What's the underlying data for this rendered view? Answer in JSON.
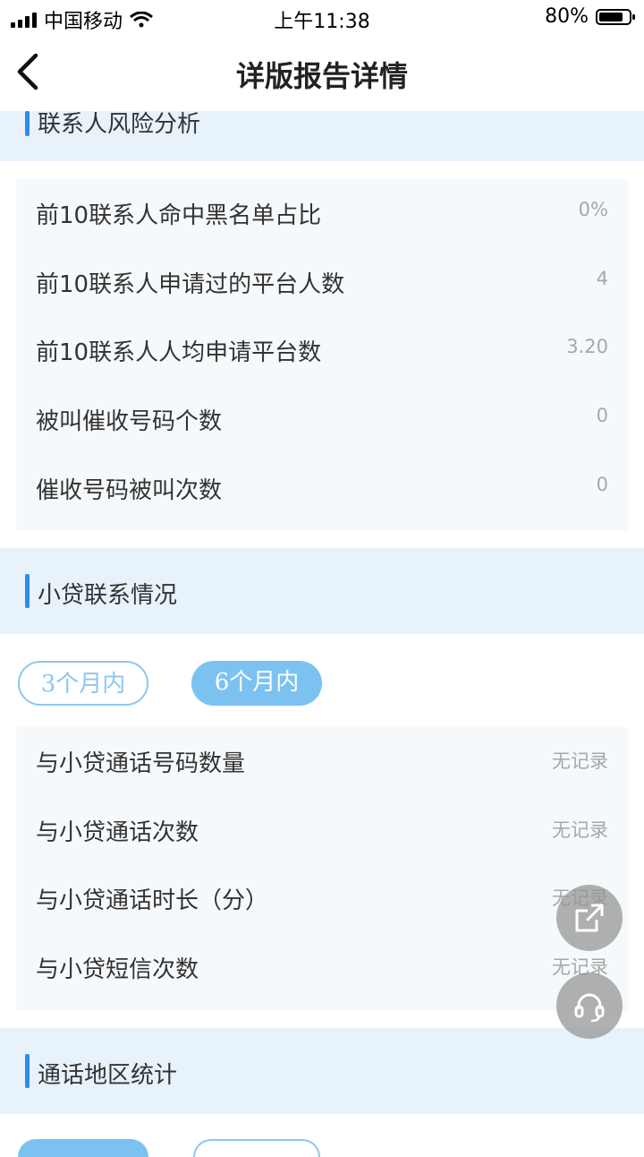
{
  "status_bar": {
    "carrier": "中国移动",
    "time": "上午11:38",
    "battery": "80%"
  },
  "nav": {
    "title": "详版报告详情"
  },
  "contacts_risk": {
    "title": "联系人风险分析",
    "rows": [
      {
        "label": "前10联系人命中黑名单占比",
        "value": "0%"
      },
      {
        "label": "前10联系人申请过的平台人数",
        "value": "4"
      },
      {
        "label": "前10联系人人均申请平台数",
        "value": "3.20"
      },
      {
        "label": "被叫催收号码个数",
        "value": "0"
      },
      {
        "label": "催收号码被叫次数",
        "value": "0"
      }
    ]
  },
  "loan_contacts": {
    "title": "小贷联系情况",
    "tabs": [
      {
        "label": "3个月内",
        "active": false
      },
      {
        "label": "6个月内",
        "active": true
      }
    ],
    "rows": [
      {
        "label": "与小贷通话号码数量",
        "value": "无记录"
      },
      {
        "label": "与小贷通话次数",
        "value": "无记录"
      },
      {
        "label": "与小贷通话时长（分）",
        "value": "无记录"
      },
      {
        "label": "与小贷短信次数",
        "value": "无记录"
      }
    ]
  },
  "call_region": {
    "title": "通话地区统计"
  },
  "floating": {
    "share_icon": "share-icon",
    "service_icon": "headset-icon"
  },
  "colors": {
    "accent": "#2f8ce6",
    "section_bg": "#e7f2fb",
    "pill_active": "#7cc2f1",
    "card_bg": "#f6f9fc"
  }
}
